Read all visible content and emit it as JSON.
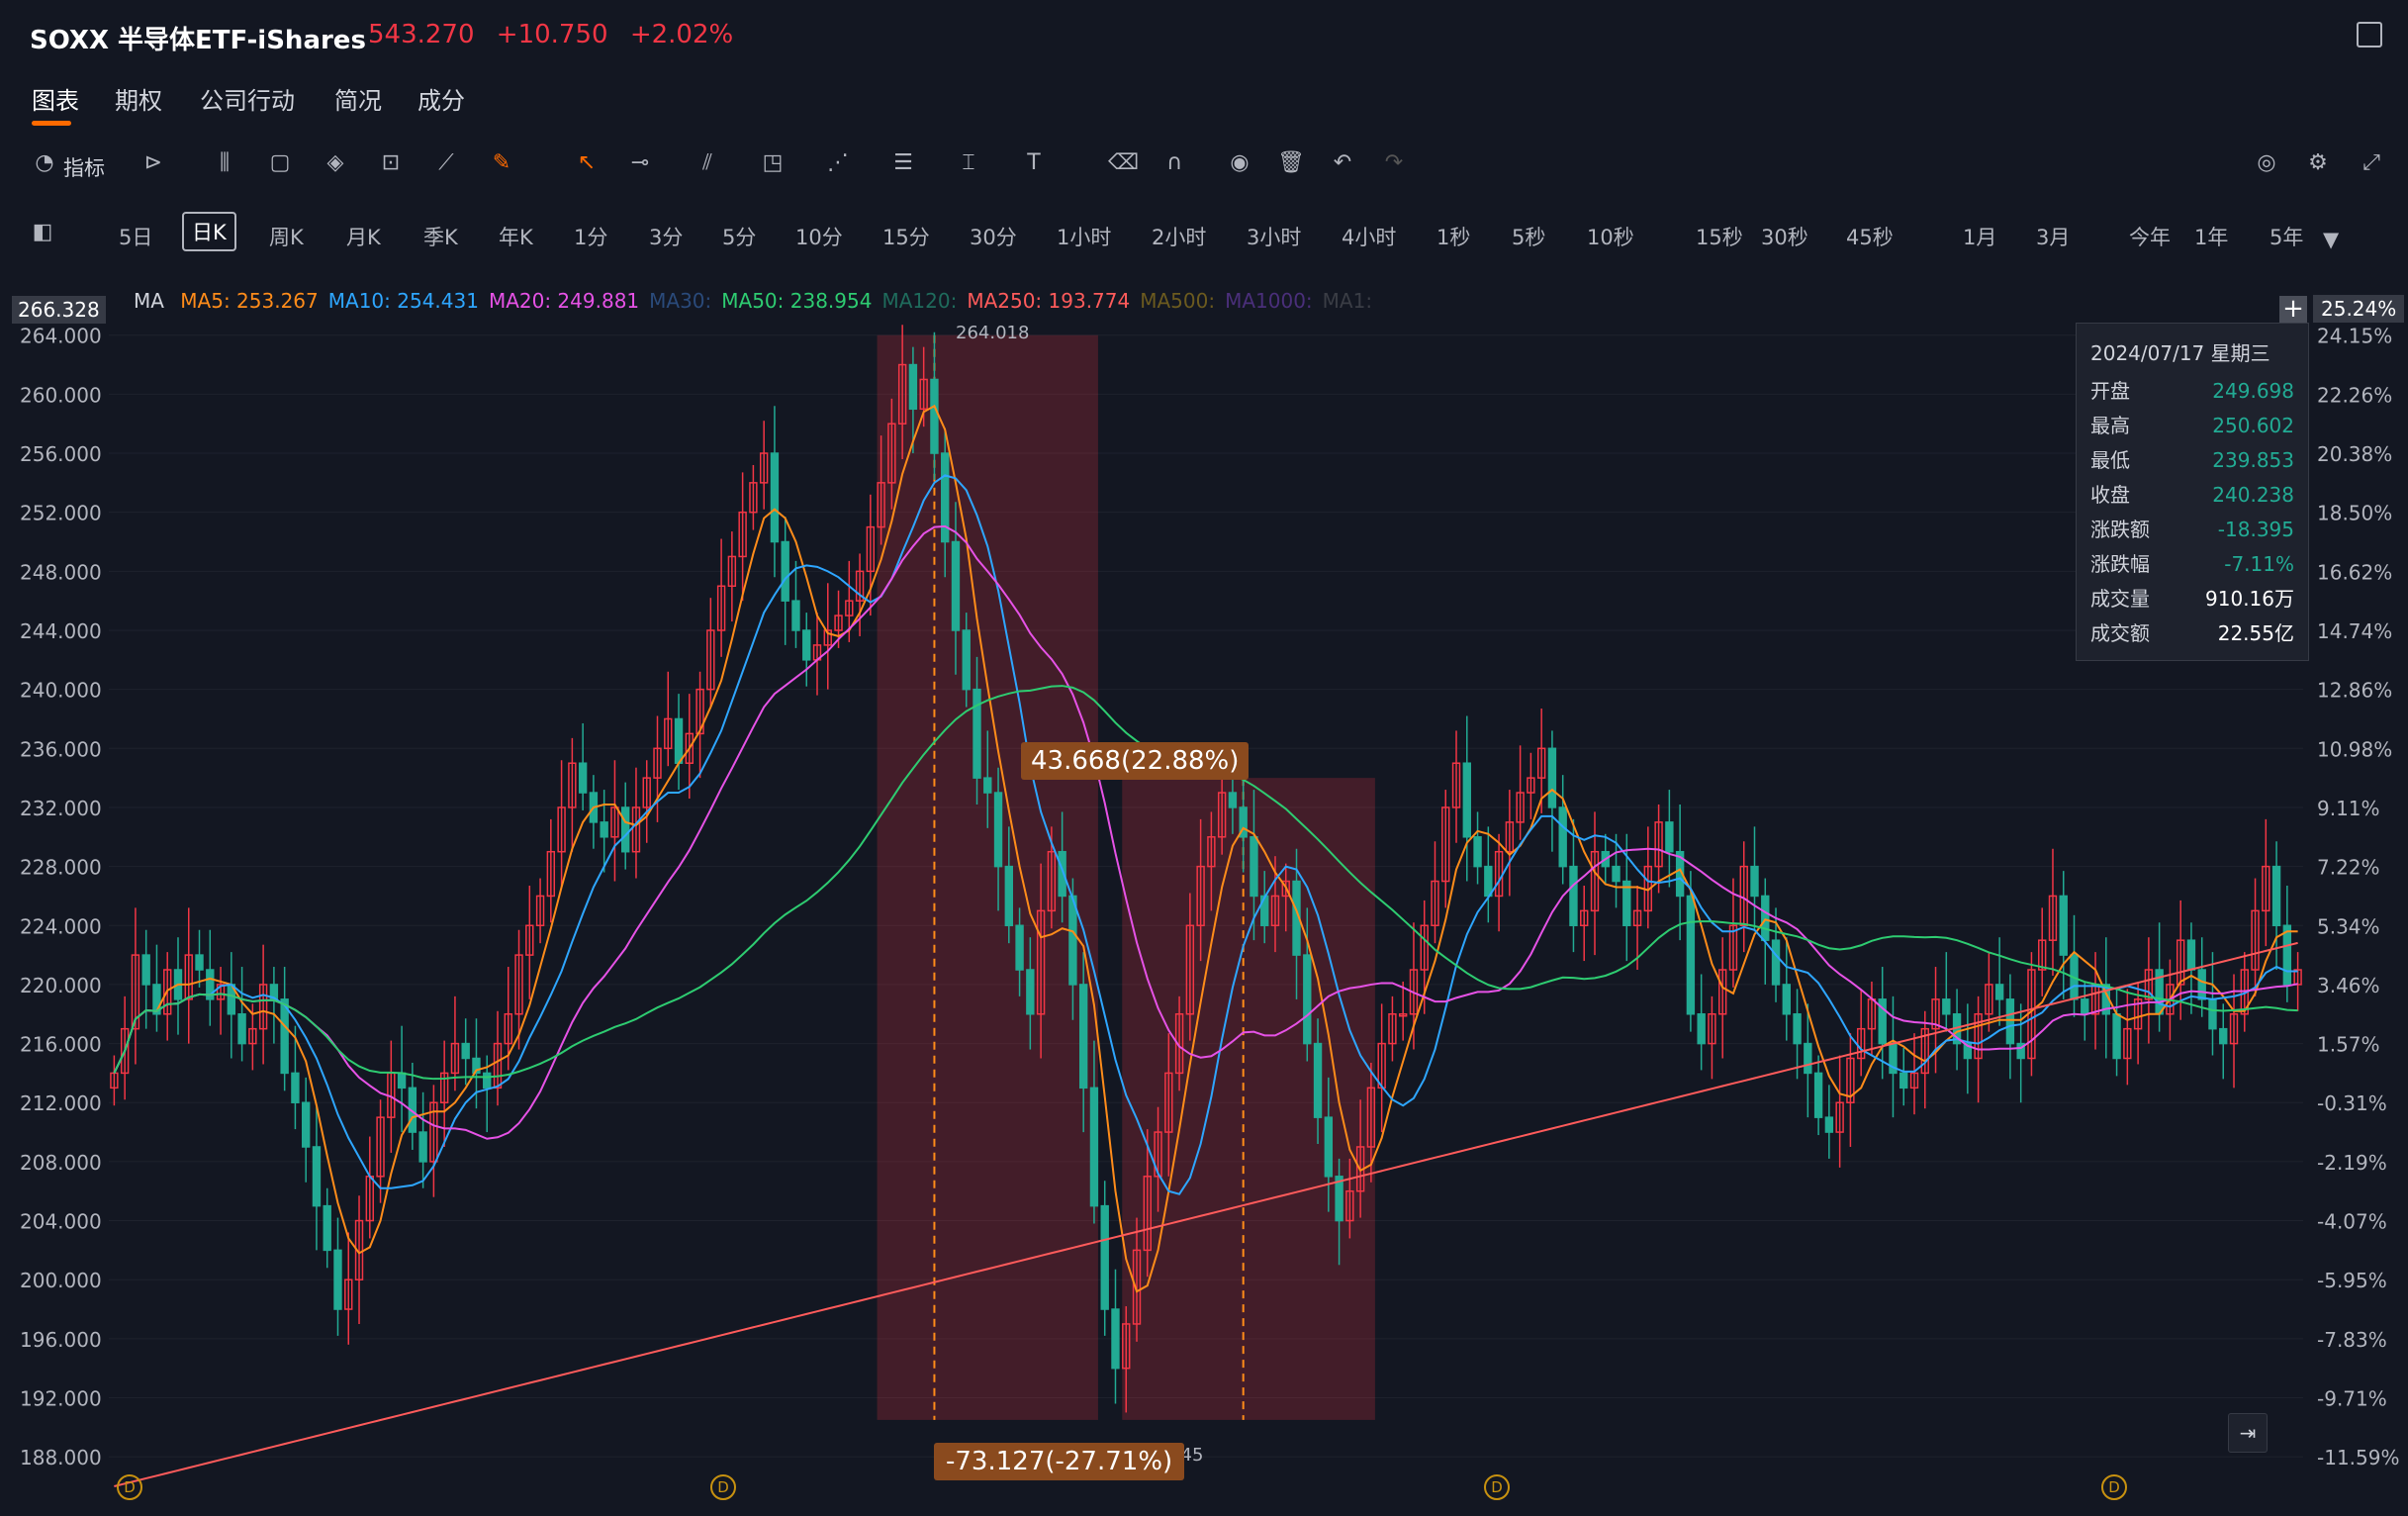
{
  "header": {
    "symbol": "SOXX 半导体ETF-iShares",
    "last_price": "543.270",
    "change": "+10.750",
    "change_pct": "+2.02%"
  },
  "nav": {
    "tabs": [
      "图表",
      "期权",
      "公司行动",
      "简况",
      "成分"
    ],
    "active": 0
  },
  "toolbar": {
    "indicator_label": "指标"
  },
  "periods": [
    "5日",
    "日K",
    "周K",
    "月K",
    "季K",
    "年K",
    "1分",
    "3分",
    "5分",
    "10分",
    "15分",
    "30分",
    "1小时",
    "2小时",
    "3小时",
    "4小时",
    "1秒",
    "5秒",
    "10秒",
    "15秒",
    "30秒",
    "45秒",
    "1月",
    "3月",
    "今年",
    "1年",
    "5年"
  ],
  "active_period": "日K",
  "ma_legend": {
    "title": "MA",
    "items": [
      {
        "label": "MA5: 253.267",
        "color": "#ff8c1a"
      },
      {
        "label": "MA10: 254.431",
        "color": "#2ea6ff"
      },
      {
        "label": "MA20: 249.881",
        "color": "#e652e6"
      },
      {
        "label": "MA30:",
        "color": "#2a4a7a"
      },
      {
        "label": "MA50: 238.954",
        "color": "#2ecc71"
      },
      {
        "label": "MA120:",
        "color": "#1f6b5c"
      },
      {
        "label": "MA250: 193.774",
        "color": "#ff5b5b"
      },
      {
        "label": "MA500:",
        "color": "#6b5a1f"
      },
      {
        "label": "MA1000:",
        "color": "#4a2f7a"
      },
      {
        "label": "MA1:",
        "color": "#3a3d45"
      }
    ]
  },
  "crosshair": {
    "price": "266.328",
    "pct": "25.24%"
  },
  "info_panel": {
    "date": "2024/07/17 星期三",
    "rows": [
      {
        "label": "开盘",
        "value": "249.698",
        "color": "green"
      },
      {
        "label": "最高",
        "value": "250.602",
        "color": "green"
      },
      {
        "label": "最低",
        "value": "239.853",
        "color": "green"
      },
      {
        "label": "收盘",
        "value": "240.238",
        "color": "green"
      },
      {
        "label": "涨跌额",
        "value": "-18.395",
        "color": "green"
      },
      {
        "label": "涨跌幅",
        "value": "-7.11%",
        "color": "green"
      },
      {
        "label": "成交量",
        "value": "910.16万",
        "color": "white"
      },
      {
        "label": "成交额",
        "value": "22.55亿",
        "color": "white"
      }
    ]
  },
  "measurements": {
    "up": "43.668(22.88%)",
    "down": "-73.127(-27.71%)"
  },
  "annotations": {
    "high": "264.018",
    "low": "190.545"
  },
  "dividend_marker": "D",
  "chart_data": {
    "type": "candlestick",
    "ylim": [
      186,
      266.328
    ],
    "y_ticks": [
      264,
      260,
      256,
      252,
      248,
      244,
      240,
      236,
      232,
      228,
      224,
      220,
      216,
      212,
      208,
      204,
      200,
      196,
      192,
      188
    ],
    "y_tick_labels": [
      "264.000",
      "260.000",
      "256.000",
      "252.000",
      "248.000",
      "244.000",
      "240.000",
      "236.000",
      "232.000",
      "228.000",
      "224.000",
      "220.000",
      "216.000",
      "212.000",
      "208.000",
      "204.000",
      "200.000",
      "196.000",
      "192.000",
      "188.000"
    ],
    "pct_labels": [
      "24.15%",
      "22.26%",
      "20.38%",
      "18.50%",
      "16.62%",
      "14.74%",
      "12.86%",
      "10.98%",
      "9.11%",
      "7.22%",
      "5.34%",
      "3.46%",
      "1.57%",
      "-0.31%",
      "-2.19%",
      "-4.07%",
      "-5.95%",
      "-7.83%",
      "-9.71%",
      "-11.59%"
    ],
    "colors": {
      "up": "#f23645",
      "down": "#22ab94"
    },
    "closes": [
      214,
      217,
      222,
      220,
      218,
      221,
      219,
      222,
      221,
      219,
      220,
      218,
      216,
      217,
      220,
      219,
      214,
      212,
      209,
      205,
      202,
      198,
      200,
      204,
      207,
      211,
      214,
      213,
      210,
      208,
      212,
      214,
      216,
      215,
      214,
      213,
      216,
      218,
      222,
      224,
      226,
      229,
      232,
      235,
      233,
      231,
      230,
      232,
      229,
      232,
      234,
      236,
      238,
      235,
      237,
      240,
      244,
      247,
      249,
      252,
      254,
      256,
      250,
      246,
      244,
      242,
      243,
      244,
      245,
      246,
      248,
      251,
      254,
      258,
      262,
      259,
      261,
      256,
      250,
      244,
      240,
      234,
      233,
      228,
      224,
      221,
      218,
      225,
      229,
      226,
      220,
      213,
      205,
      198,
      194,
      197,
      202,
      207,
      210,
      214,
      218,
      224,
      228,
      230,
      233,
      232,
      230,
      226,
      224,
      226,
      227,
      222,
      216,
      211,
      207,
      204,
      206,
      209,
      213,
      216,
      218,
      218,
      221,
      224,
      227,
      232,
      235,
      230,
      228,
      226,
      229,
      231,
      233,
      234,
      236,
      232,
      228,
      224,
      225,
      229,
      228,
      227,
      224,
      225,
      228,
      231,
      229,
      226,
      218,
      216,
      218,
      221,
      224,
      228,
      226,
      223,
      220,
      218,
      216,
      214,
      211,
      210,
      212,
      215,
      217,
      219,
      216,
      214,
      213,
      214,
      217,
      219,
      218,
      216,
      215,
      218,
      220,
      219,
      216,
      215,
      221,
      223,
      226,
      222,
      219,
      218,
      220,
      218,
      215,
      217,
      219,
      221,
      218,
      220,
      223,
      221,
      219,
      217,
      216,
      218,
      221,
      225,
      228,
      224,
      220,
      221
    ]
  }
}
